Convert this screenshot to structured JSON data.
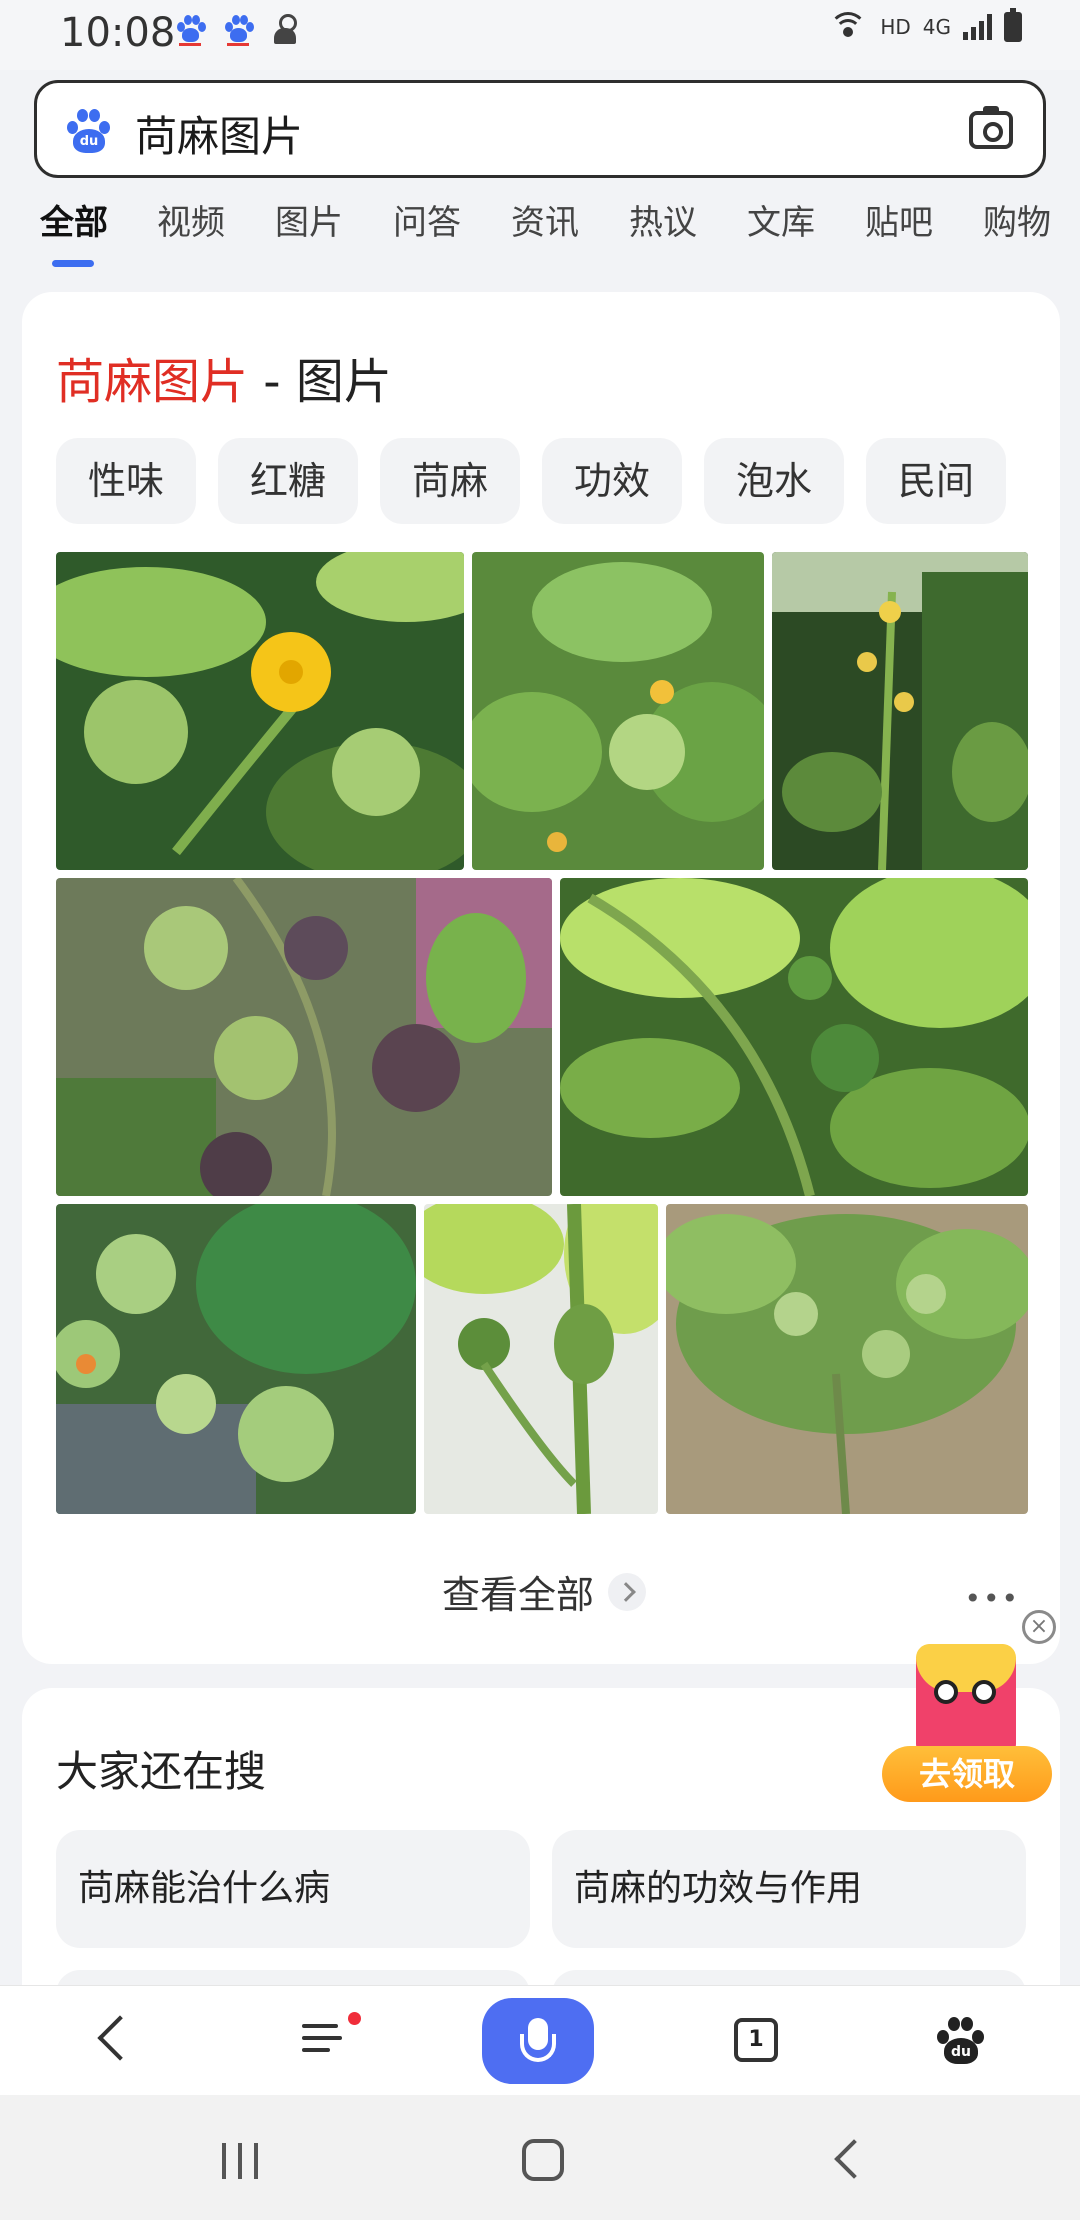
{
  "status": {
    "time": "10:08",
    "network_label": "HD",
    "network_type": "4G"
  },
  "search": {
    "query": "苘麻图片"
  },
  "tabs": [
    "全部",
    "视频",
    "图片",
    "问答",
    "资讯",
    "热议",
    "文库",
    "贴吧",
    "购物"
  ],
  "image_card": {
    "title_highlight": "苘麻图片",
    "title_suffix": " - 图片",
    "chips": [
      "性味",
      "红糖",
      "苘麻",
      "功效",
      "泡水",
      "民间"
    ],
    "view_all": "查看全部",
    "more": "•••"
  },
  "promo": {
    "close": "×",
    "button_label": "去领取"
  },
  "related": {
    "title": "大家还在搜",
    "items": [
      "苘麻能治什么病",
      "苘麻的功效与作用"
    ]
  },
  "bottom_bar": {
    "tab_count": "1",
    "paw_label": "du",
    "logo_label": "du"
  },
  "colors": {
    "accent": "#3d6df0",
    "highlight": "#e02e24",
    "mic": "#4e6ef2",
    "promo_button": "#ff9a1a"
  }
}
